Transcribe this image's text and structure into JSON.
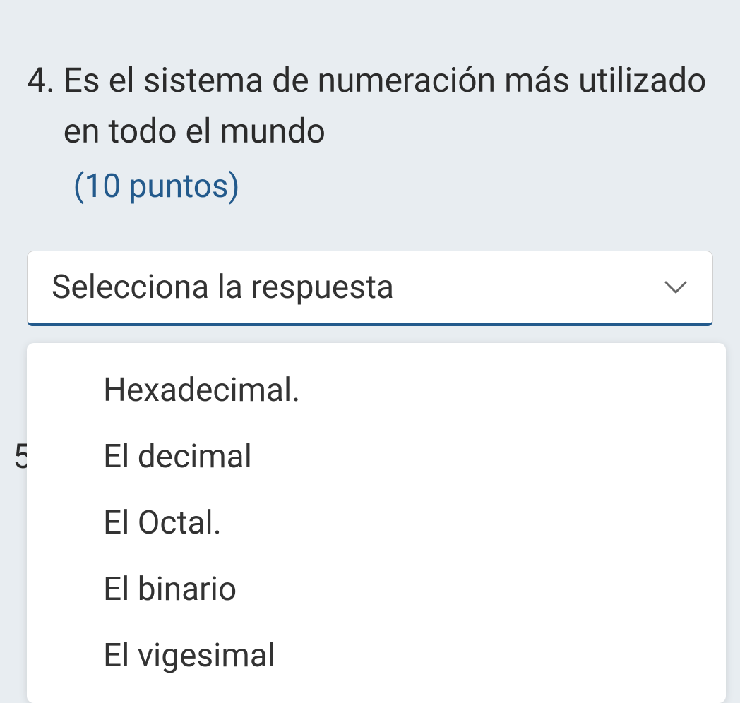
{
  "question": {
    "number": "4.",
    "text": "Es el sistema de numeración más utilizado  en todo el mundo",
    "points": "(10 puntos)"
  },
  "select": {
    "placeholder": "Selecciona la respuesta",
    "options": [
      "Hexadecimal.",
      "El decimal",
      "El Octal.",
      "El binario",
      "El vigesimal"
    ]
  },
  "next_question_number": "5"
}
